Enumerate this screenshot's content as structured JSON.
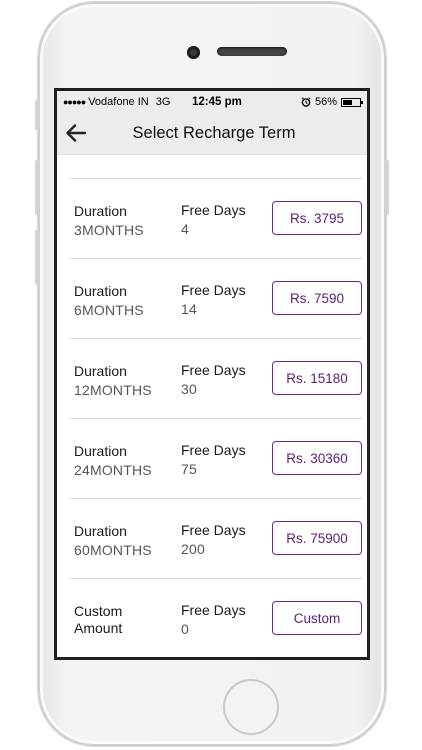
{
  "status_bar": {
    "signal": "●●●●●",
    "carrier": "Vodafone IN",
    "network": "3G",
    "time": "12:45 pm",
    "battery": "56%",
    "battery_level": 0.56
  },
  "nav": {
    "title": "Select Recharge Term",
    "back_icon": "arrow-left-icon"
  },
  "plans": [
    {
      "label": "Duration",
      "duration": "3MONTHS",
      "free_label": "Free Days",
      "free_days": "4",
      "price": "Rs. 3795"
    },
    {
      "label": "Duration",
      "duration": "6MONTHS",
      "free_label": "Free Days",
      "free_days": "14",
      "price": "Rs. 7590"
    },
    {
      "label": "Duration",
      "duration": "12MONTHS",
      "free_label": "Free Days",
      "free_days": "30",
      "price": "Rs. 15180"
    },
    {
      "label": "Duration",
      "duration": "24MONTHS",
      "free_label": "Free Days",
      "free_days": "75",
      "price": "Rs. 30360"
    },
    {
      "label": "Duration",
      "duration": "60MONTHS",
      "free_label": "Free Days",
      "free_days": "200",
      "price": "Rs. 75900"
    }
  ],
  "custom": {
    "label": "Custom Amount",
    "free_label": "Free Days",
    "free_days": "0",
    "button": "Custom"
  },
  "colors": {
    "accent": "#6d2a8a",
    "header_bg": "#ececec"
  }
}
